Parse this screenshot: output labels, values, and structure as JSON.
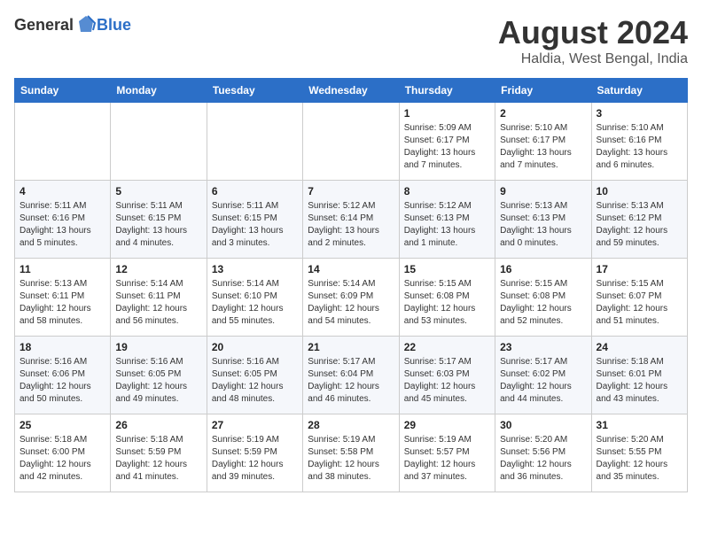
{
  "header": {
    "logo_general": "General",
    "logo_blue": "Blue",
    "month_year": "August 2024",
    "location": "Haldia, West Bengal, India"
  },
  "days_of_week": [
    "Sunday",
    "Monday",
    "Tuesday",
    "Wednesday",
    "Thursday",
    "Friday",
    "Saturday"
  ],
  "weeks": [
    [
      {
        "day": "",
        "sunrise": "",
        "sunset": "",
        "daylight": ""
      },
      {
        "day": "",
        "sunrise": "",
        "sunset": "",
        "daylight": ""
      },
      {
        "day": "",
        "sunrise": "",
        "sunset": "",
        "daylight": ""
      },
      {
        "day": "",
        "sunrise": "",
        "sunset": "",
        "daylight": ""
      },
      {
        "day": "1",
        "sunrise": "Sunrise: 5:09 AM",
        "sunset": "Sunset: 6:17 PM",
        "daylight": "Daylight: 13 hours and 7 minutes."
      },
      {
        "day": "2",
        "sunrise": "Sunrise: 5:10 AM",
        "sunset": "Sunset: 6:17 PM",
        "daylight": "Daylight: 13 hours and 7 minutes."
      },
      {
        "day": "3",
        "sunrise": "Sunrise: 5:10 AM",
        "sunset": "Sunset: 6:16 PM",
        "daylight": "Daylight: 13 hours and 6 minutes."
      }
    ],
    [
      {
        "day": "4",
        "sunrise": "Sunrise: 5:11 AM",
        "sunset": "Sunset: 6:16 PM",
        "daylight": "Daylight: 13 hours and 5 minutes."
      },
      {
        "day": "5",
        "sunrise": "Sunrise: 5:11 AM",
        "sunset": "Sunset: 6:15 PM",
        "daylight": "Daylight: 13 hours and 4 minutes."
      },
      {
        "day": "6",
        "sunrise": "Sunrise: 5:11 AM",
        "sunset": "Sunset: 6:15 PM",
        "daylight": "Daylight: 13 hours and 3 minutes."
      },
      {
        "day": "7",
        "sunrise": "Sunrise: 5:12 AM",
        "sunset": "Sunset: 6:14 PM",
        "daylight": "Daylight: 13 hours and 2 minutes."
      },
      {
        "day": "8",
        "sunrise": "Sunrise: 5:12 AM",
        "sunset": "Sunset: 6:13 PM",
        "daylight": "Daylight: 13 hours and 1 minute."
      },
      {
        "day": "9",
        "sunrise": "Sunrise: 5:13 AM",
        "sunset": "Sunset: 6:13 PM",
        "daylight": "Daylight: 13 hours and 0 minutes."
      },
      {
        "day": "10",
        "sunrise": "Sunrise: 5:13 AM",
        "sunset": "Sunset: 6:12 PM",
        "daylight": "Daylight: 12 hours and 59 minutes."
      }
    ],
    [
      {
        "day": "11",
        "sunrise": "Sunrise: 5:13 AM",
        "sunset": "Sunset: 6:11 PM",
        "daylight": "Daylight: 12 hours and 58 minutes."
      },
      {
        "day": "12",
        "sunrise": "Sunrise: 5:14 AM",
        "sunset": "Sunset: 6:11 PM",
        "daylight": "Daylight: 12 hours and 56 minutes."
      },
      {
        "day": "13",
        "sunrise": "Sunrise: 5:14 AM",
        "sunset": "Sunset: 6:10 PM",
        "daylight": "Daylight: 12 hours and 55 minutes."
      },
      {
        "day": "14",
        "sunrise": "Sunrise: 5:14 AM",
        "sunset": "Sunset: 6:09 PM",
        "daylight": "Daylight: 12 hours and 54 minutes."
      },
      {
        "day": "15",
        "sunrise": "Sunrise: 5:15 AM",
        "sunset": "Sunset: 6:08 PM",
        "daylight": "Daylight: 12 hours and 53 minutes."
      },
      {
        "day": "16",
        "sunrise": "Sunrise: 5:15 AM",
        "sunset": "Sunset: 6:08 PM",
        "daylight": "Daylight: 12 hours and 52 minutes."
      },
      {
        "day": "17",
        "sunrise": "Sunrise: 5:15 AM",
        "sunset": "Sunset: 6:07 PM",
        "daylight": "Daylight: 12 hours and 51 minutes."
      }
    ],
    [
      {
        "day": "18",
        "sunrise": "Sunrise: 5:16 AM",
        "sunset": "Sunset: 6:06 PM",
        "daylight": "Daylight: 12 hours and 50 minutes."
      },
      {
        "day": "19",
        "sunrise": "Sunrise: 5:16 AM",
        "sunset": "Sunset: 6:05 PM",
        "daylight": "Daylight: 12 hours and 49 minutes."
      },
      {
        "day": "20",
        "sunrise": "Sunrise: 5:16 AM",
        "sunset": "Sunset: 6:05 PM",
        "daylight": "Daylight: 12 hours and 48 minutes."
      },
      {
        "day": "21",
        "sunrise": "Sunrise: 5:17 AM",
        "sunset": "Sunset: 6:04 PM",
        "daylight": "Daylight: 12 hours and 46 minutes."
      },
      {
        "day": "22",
        "sunrise": "Sunrise: 5:17 AM",
        "sunset": "Sunset: 6:03 PM",
        "daylight": "Daylight: 12 hours and 45 minutes."
      },
      {
        "day": "23",
        "sunrise": "Sunrise: 5:17 AM",
        "sunset": "Sunset: 6:02 PM",
        "daylight": "Daylight: 12 hours and 44 minutes."
      },
      {
        "day": "24",
        "sunrise": "Sunrise: 5:18 AM",
        "sunset": "Sunset: 6:01 PM",
        "daylight": "Daylight: 12 hours and 43 minutes."
      }
    ],
    [
      {
        "day": "25",
        "sunrise": "Sunrise: 5:18 AM",
        "sunset": "Sunset: 6:00 PM",
        "daylight": "Daylight: 12 hours and 42 minutes."
      },
      {
        "day": "26",
        "sunrise": "Sunrise: 5:18 AM",
        "sunset": "Sunset: 5:59 PM",
        "daylight": "Daylight: 12 hours and 41 minutes."
      },
      {
        "day": "27",
        "sunrise": "Sunrise: 5:19 AM",
        "sunset": "Sunset: 5:59 PM",
        "daylight": "Daylight: 12 hours and 39 minutes."
      },
      {
        "day": "28",
        "sunrise": "Sunrise: 5:19 AM",
        "sunset": "Sunset: 5:58 PM",
        "daylight": "Daylight: 12 hours and 38 minutes."
      },
      {
        "day": "29",
        "sunrise": "Sunrise: 5:19 AM",
        "sunset": "Sunset: 5:57 PM",
        "daylight": "Daylight: 12 hours and 37 minutes."
      },
      {
        "day": "30",
        "sunrise": "Sunrise: 5:20 AM",
        "sunset": "Sunset: 5:56 PM",
        "daylight": "Daylight: 12 hours and 36 minutes."
      },
      {
        "day": "31",
        "sunrise": "Sunrise: 5:20 AM",
        "sunset": "Sunset: 5:55 PM",
        "daylight": "Daylight: 12 hours and 35 minutes."
      }
    ]
  ]
}
